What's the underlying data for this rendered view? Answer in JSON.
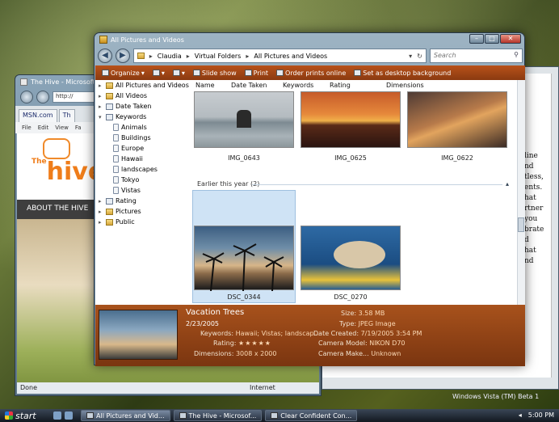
{
  "ie_window": {
    "title": "The Hive - Microsoft...",
    "address_partial": "http://",
    "tabs": [
      "MSN.com",
      "Th"
    ],
    "menu": [
      "File",
      "Edit",
      "View",
      "Fa"
    ],
    "logo_text": "hive",
    "logo_prefix": "The",
    "nav_text": "ABOUT THE HIVE",
    "status_left": "Done",
    "status_zone": "Internet"
  },
  "doc_window": {
    "side_words": [
      "line",
      "nd",
      "tless,",
      "ents.",
      "hat",
      "rtner",
      "you",
      "brate",
      "d",
      "hat",
      "nd"
    ]
  },
  "explorer": {
    "title": "All Pictures and Videos",
    "breadcrumb": [
      "Claudia",
      "Virtual Folders",
      "All Pictures and Videos"
    ],
    "search_placeholder": "Search",
    "toolbar": [
      "Organize",
      "Slide show",
      "Print",
      "Order prints online",
      "Set as desktop background"
    ],
    "tree": [
      {
        "label": "All Pictures and Videos",
        "icon": "folder-icon"
      },
      {
        "label": "All Videos",
        "icon": "folder-icon"
      },
      {
        "label": "Date Taken",
        "icon": "calendar-icon"
      },
      {
        "label": "Keywords",
        "icon": "tag-icon"
      },
      {
        "label": "Animals",
        "icon": "tag-icon"
      },
      {
        "label": "Buildings",
        "icon": "tag-icon"
      },
      {
        "label": "Europe",
        "icon": "tag-icon"
      },
      {
        "label": "Hawaii",
        "icon": "tag-icon"
      },
      {
        "label": "landscapes",
        "icon": "tag-icon"
      },
      {
        "label": "Tokyo",
        "icon": "tag-icon"
      },
      {
        "label": "Vistas",
        "icon": "tag-icon"
      },
      {
        "label": "Rating",
        "icon": "star-icon"
      },
      {
        "label": "Pictures",
        "icon": "folder-icon"
      },
      {
        "label": "Public",
        "icon": "folder-icon"
      }
    ],
    "columns": [
      "Name",
      "Date Taken",
      "Keywords",
      "Rating",
      "Dimensions"
    ],
    "top_files": [
      "IMG_0643",
      "IMG_0625",
      "IMG_0622"
    ],
    "group_header": "Earlier this year (2)",
    "group_files": [
      "DSC_0344",
      "DSC_0270"
    ],
    "details": {
      "title": "Vacation Trees",
      "date": "2/23/2005",
      "keywords_label": "Keywords:",
      "keywords": "Hawaii; Vistas; landscap...",
      "rating_label": "Rating:",
      "rating_stars": 5,
      "dimensions_label": "Dimensions:",
      "dimensions": "3008 x 2000",
      "size_label": "Size:",
      "size": "3.58 MB",
      "type_label": "Type:",
      "type": "JPEG Image",
      "created_label": "Date Created:",
      "created": "7/19/2005 3:54 PM",
      "model_label": "Camera Model:",
      "model": "NIKON D70",
      "make_label": "Camera Make...",
      "make": "Unknown"
    }
  },
  "taskbar": {
    "start_label": "start",
    "tasks": [
      "All Pictures and Vid...",
      "The Hive - Microsof...",
      "Clear Confident Con..."
    ],
    "clock": "5:00 PM",
    "watermark": "Windows Vista (TM) Beta 1"
  }
}
